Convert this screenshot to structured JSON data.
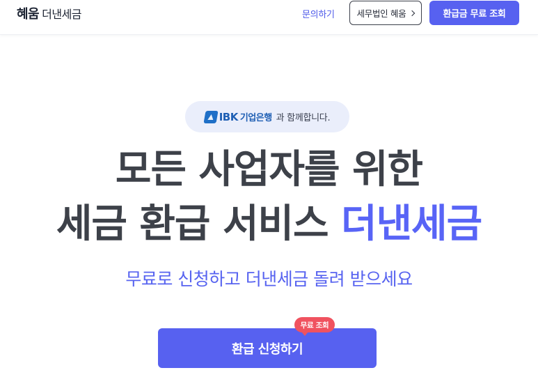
{
  "header": {
    "logo_main": "혜움",
    "logo_sub": "더낸세금",
    "nav_inquiry": "문의하기",
    "partner_button": "세무법인 혜움",
    "cta_button": "환급금 무료 조회"
  },
  "hero": {
    "partner_logo_en": "IBK",
    "partner_logo_kr": "기업은행",
    "partner_suffix": "과 함께합니다.",
    "headline_line1": "모든 사업자를 위한",
    "headline_line2_prefix": "세금 환급 서비스",
    "headline_line2_accent": "더낸세금",
    "subheadline": "무료로 신청하고 더낸세금 돌려 받으세요",
    "apply_button": "환급 신청하기",
    "badge": "무료 조회"
  },
  "icons": {
    "partner_chevron": "chevron-right-icon",
    "ibk_mark": "ibk-logo-icon"
  },
  "colors": {
    "accent": "#5761f0",
    "badge": "#f0525f",
    "headline": "#3d4149",
    "pill_bg": "#eaeefb"
  }
}
